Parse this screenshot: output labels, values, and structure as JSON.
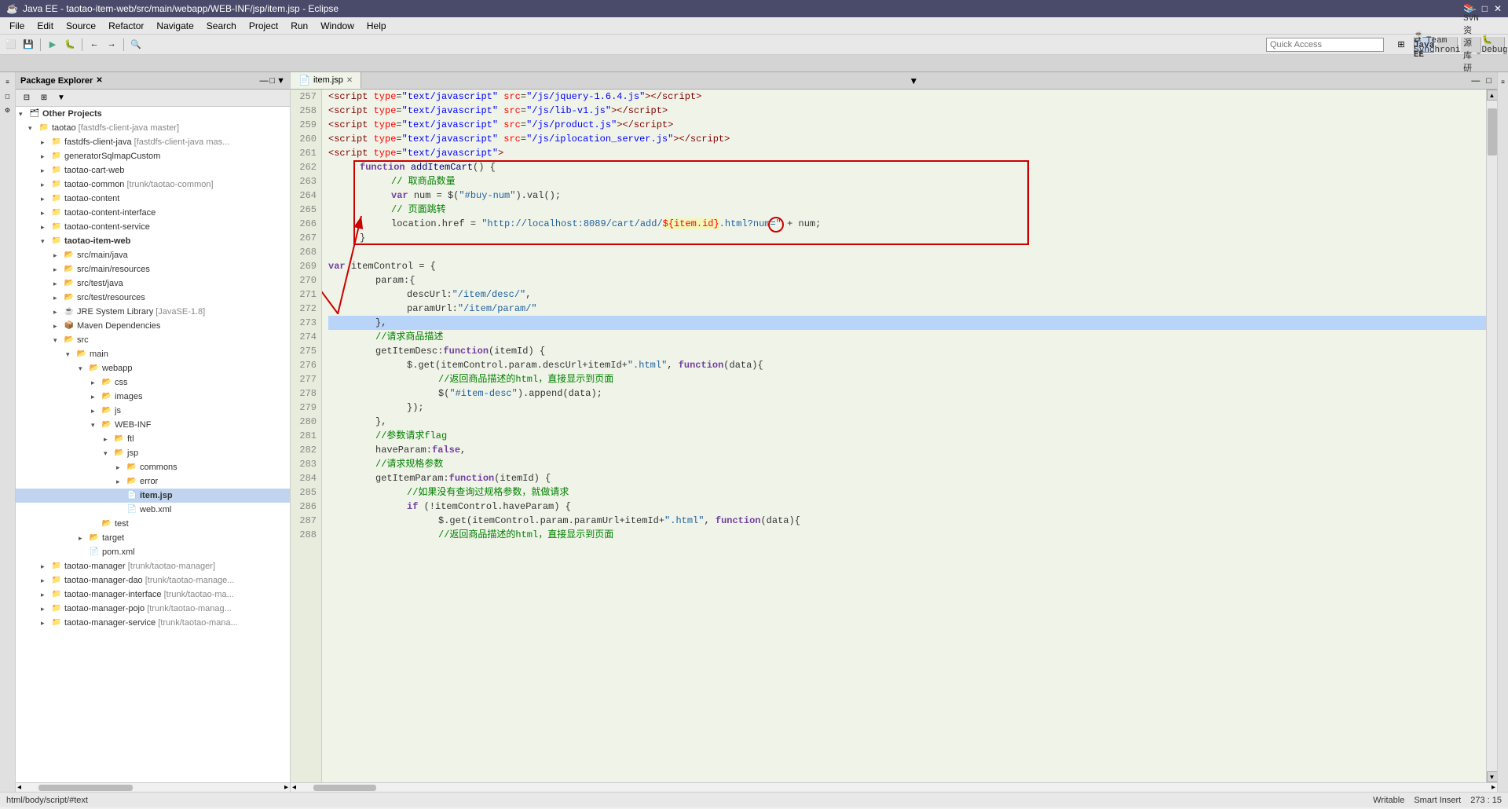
{
  "window": {
    "title": "Java EE - taotao-item-web/src/main/webapp/WEB-INF/jsp/item.jsp - Eclipse",
    "min_label": "—",
    "max_label": "□",
    "close_label": "✕"
  },
  "menubar": {
    "items": [
      "File",
      "Edit",
      "Source",
      "Refactor",
      "Navigate",
      "Search",
      "Project",
      "Run",
      "Window",
      "Help"
    ]
  },
  "toolbar": {
    "quick_access_placeholder": "Quick Access"
  },
  "perspectives": {
    "items": [
      {
        "label": "Java EE",
        "active": true
      },
      {
        "label": "Team Synchronizing"
      },
      {
        "label": "SVN 资源库研究"
      },
      {
        "label": "Debug"
      }
    ]
  },
  "package_explorer": {
    "title": "Package Explorer",
    "other_projects_label": "Other Projects",
    "tree": [
      {
        "indent": 0,
        "arrow": "▾",
        "icon": "📁",
        "label": "Other Projects",
        "style": "bold"
      },
      {
        "indent": 1,
        "arrow": "▾",
        "icon": "📁",
        "label": "taotao",
        "label2": "[fastdfs-client-java master]"
      },
      {
        "indent": 2,
        "arrow": "▸",
        "icon": "📁",
        "label": "fastdfs-client-java",
        "label2": "[fastdfs-client-java mas"
      },
      {
        "indent": 2,
        "arrow": "▸",
        "icon": "📁",
        "label": "generatorSqlmapCustom"
      },
      {
        "indent": 2,
        "arrow": "▸",
        "icon": "📁",
        "label": "taotao-cart-web"
      },
      {
        "indent": 2,
        "arrow": "▸",
        "icon": "📁",
        "label": "taotao-common",
        "label2": "[trunk/taotao-common]"
      },
      {
        "indent": 2,
        "arrow": "▸",
        "icon": "📁",
        "label": "taotao-content"
      },
      {
        "indent": 2,
        "arrow": "▸",
        "icon": "📁",
        "label": "taotao-content-interface"
      },
      {
        "indent": 2,
        "arrow": "▸",
        "icon": "📁",
        "label": "taotao-content-service"
      },
      {
        "indent": 2,
        "arrow": "▾",
        "icon": "📁",
        "label": "taotao-item-web",
        "active": true
      },
      {
        "indent": 3,
        "arrow": "▸",
        "icon": "📂",
        "label": "src/main/java"
      },
      {
        "indent": 3,
        "arrow": "▸",
        "icon": "📂",
        "label": "src/main/resources"
      },
      {
        "indent": 3,
        "arrow": "▸",
        "icon": "📂",
        "label": "src/test/java"
      },
      {
        "indent": 3,
        "arrow": "▸",
        "icon": "📂",
        "label": "src/test/resources"
      },
      {
        "indent": 3,
        "arrow": "▸",
        "icon": "☕",
        "label": "JRE System Library",
        "label2": "[JavaSE-1.8]"
      },
      {
        "indent": 3,
        "arrow": "▸",
        "icon": "📦",
        "label": "Maven Dependencies"
      },
      {
        "indent": 3,
        "arrow": "▾",
        "icon": "📂",
        "label": "src"
      },
      {
        "indent": 4,
        "arrow": "▾",
        "icon": "📂",
        "label": "main"
      },
      {
        "indent": 5,
        "arrow": "▾",
        "icon": "📂",
        "label": "webapp"
      },
      {
        "indent": 6,
        "arrow": "▸",
        "icon": "📂",
        "label": "css"
      },
      {
        "indent": 6,
        "arrow": "▸",
        "icon": "📂",
        "label": "images"
      },
      {
        "indent": 6,
        "arrow": "▸",
        "icon": "📂",
        "label": "js"
      },
      {
        "indent": 6,
        "arrow": "▾",
        "icon": "📂",
        "label": "WEB-INF"
      },
      {
        "indent": 7,
        "arrow": "▸",
        "icon": "📂",
        "label": "ftl"
      },
      {
        "indent": 7,
        "arrow": "▾",
        "icon": "📂",
        "label": "jsp"
      },
      {
        "indent": 8,
        "arrow": "▸",
        "icon": "📂",
        "label": "commons"
      },
      {
        "indent": 8,
        "arrow": "▸",
        "icon": "📂",
        "label": "error"
      },
      {
        "indent": 8,
        "arrow": " ",
        "icon": "📄",
        "label": "item.jsp",
        "selected": true
      },
      {
        "indent": 8,
        "arrow": " ",
        "icon": "📄",
        "label": "web.xml"
      },
      {
        "indent": 6,
        "arrow": " ",
        "icon": "📂",
        "label": "test"
      },
      {
        "indent": 5,
        "arrow": "▸",
        "icon": "📂",
        "label": "target"
      },
      {
        "indent": 5,
        "arrow": " ",
        "icon": "📄",
        "label": "pom.xml"
      },
      {
        "indent": 2,
        "arrow": "▸",
        "icon": "📁",
        "label": "taotao-manager",
        "label2": "[trunk/taotao-manager]"
      },
      {
        "indent": 2,
        "arrow": "▸",
        "icon": "📁",
        "label": "taotao-manager-dao",
        "label2": "[trunk/taotao-manage"
      },
      {
        "indent": 2,
        "arrow": "▸",
        "icon": "📁",
        "label": "taotao-manager-interface",
        "label2": "[trunk/taotao-ma"
      },
      {
        "indent": 2,
        "arrow": "▸",
        "icon": "📁",
        "label": "taotao-manager-pojo",
        "label2": "[trunk/taotao-manag"
      },
      {
        "indent": 2,
        "arrow": "▸",
        "icon": "📁",
        "label": "taotao-manager-service",
        "label2": "[trunk/taotao-mana"
      }
    ]
  },
  "editor": {
    "filename": "item.jsp",
    "lines": [
      {
        "num": 257,
        "content": "<script type=\"text/javascript\" src=\"/js/jquery-1.6.4.js\"><\\/script>"
      },
      {
        "num": 258,
        "content": "<script type=\"text/javascript\" src=\"/js/lib-v1.js\"><\\/script>"
      },
      {
        "num": 259,
        "content": "<script type=\"text/javascript\" src=\"/js/product.js\"><\\/script>"
      },
      {
        "num": 260,
        "content": "<script type=\"text/javascript\" src=\"/js/iplocation_server.js\"><\\/script>"
      },
      {
        "num": 261,
        "content": "<script type=\"text/javascript\">"
      },
      {
        "num": 262,
        "content": "function addItemCart() {"
      },
      {
        "num": 263,
        "content": "    // 取商品数量"
      },
      {
        "num": 264,
        "content": "    var num = $(\"#buy-num\").val();"
      },
      {
        "num": 265,
        "content": "    // 页面跳转"
      },
      {
        "num": 266,
        "content": "    location.href = \"http://localhost:8089/cart/add/${item.id}.html?num=\" + num;"
      },
      {
        "num": 267,
        "content": "}"
      },
      {
        "num": 268,
        "content": ""
      },
      {
        "num": 269,
        "content": "var itemControl = {"
      },
      {
        "num": 270,
        "content": "    param:{"
      },
      {
        "num": 271,
        "content": "        descUrl:\"/item/desc/\","
      },
      {
        "num": 272,
        "content": "        paramUrl:\"/item/param/\""
      },
      {
        "num": 273,
        "content": "    },",
        "highlighted": true
      },
      {
        "num": 274,
        "content": "    //请求商品描述"
      },
      {
        "num": 275,
        "content": "    getItemDesc:function(itemId) {"
      },
      {
        "num": 276,
        "content": "        $.get(itemControl.param.descUrl+itemId+\".html\", function(data){"
      },
      {
        "num": 277,
        "content": "            //返回商品描述的html，直接显示到页面"
      },
      {
        "num": 278,
        "content": "            $(\"#item-desc\").append(data);"
      },
      {
        "num": 279,
        "content": "        });"
      },
      {
        "num": 280,
        "content": "    },"
      },
      {
        "num": 281,
        "content": "    //参数请求flag"
      },
      {
        "num": 282,
        "content": "    haveParam:false,"
      },
      {
        "num": 283,
        "content": "    //请求规格参数"
      },
      {
        "num": 284,
        "content": "    getItemParam:function(itemId) {"
      },
      {
        "num": 285,
        "content": "        //如果没有查询过规格参数，就做请求"
      },
      {
        "num": 286,
        "content": "        if (!itemControl.haveParam) {"
      },
      {
        "num": 287,
        "content": "            $.get(itemControl.param.paramUrl+itemId+\".html\", function(data){"
      },
      {
        "num": 288,
        "content": "            //返回商品描述的html，直接显示到页面"
      }
    ]
  },
  "status_bar": {
    "left": "html/body/script/#text",
    "writable": "Writable",
    "insert_mode": "Smart Insert",
    "position": "273 : 15"
  },
  "icons": {
    "chevron_right": "▸",
    "chevron_down": "▾",
    "close": "✕",
    "minimize": "—",
    "maximize": "□"
  }
}
